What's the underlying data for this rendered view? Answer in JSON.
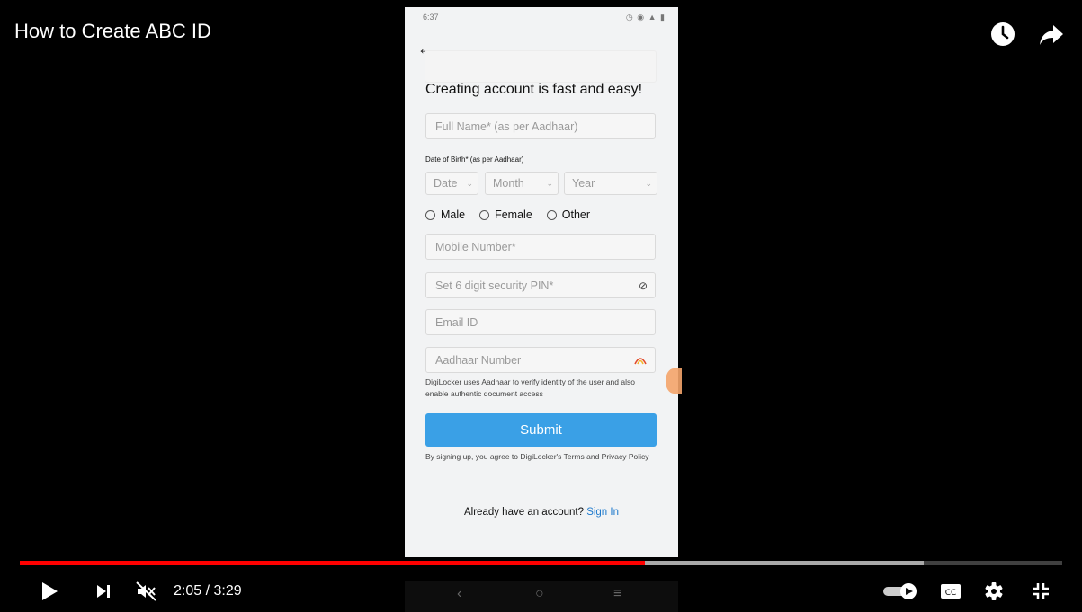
{
  "video": {
    "title": "How to Create ABC ID",
    "current_time": "2:05",
    "separator": " / ",
    "duration": "3:29",
    "progress_played": 0.6,
    "progress_buffered": 0.867
  },
  "icons": {
    "watch_later": "clock-icon",
    "share": "share-arrow-icon",
    "play": "play-icon",
    "next": "next-icon",
    "mute": "volume-muted-icon",
    "autoplay": "autoplay-toggle-icon",
    "captions": "cc-icon",
    "settings": "gear-icon",
    "fullscreen_exit": "exit-fullscreen-icon"
  },
  "captions_label": "CC",
  "colors": {
    "progress_played": "#ff0000",
    "submit_button": "#3aa0e6",
    "link": "#1f7acc"
  },
  "phone": {
    "status_time": "6:37",
    "heading": "Creating account is fast and easy!",
    "full_name_placeholder": "Full Name* (as per Aadhaar)",
    "dob_label": "Date of Birth* (as per Aadhaar)",
    "date_placeholder": "Date",
    "month_placeholder": "Month",
    "year_placeholder": "Year",
    "gender_options": [
      "Male",
      "Female",
      "Other"
    ],
    "mobile_placeholder": "Mobile Number*",
    "pin_placeholder": "Set 6 digit security PIN*",
    "email_placeholder": "Email ID",
    "aadhaar_placeholder": "Aadhaar Number",
    "aadhaar_note": "DigiLocker uses Aadhaar to verify identity of the user and also enable authentic document access",
    "submit_label": "Submit",
    "terms_text": "By signing up, you agree to DigiLocker's Terms and Privacy Policy",
    "signin_prompt": "Already have an account?",
    "signin_link": "Sign In"
  }
}
